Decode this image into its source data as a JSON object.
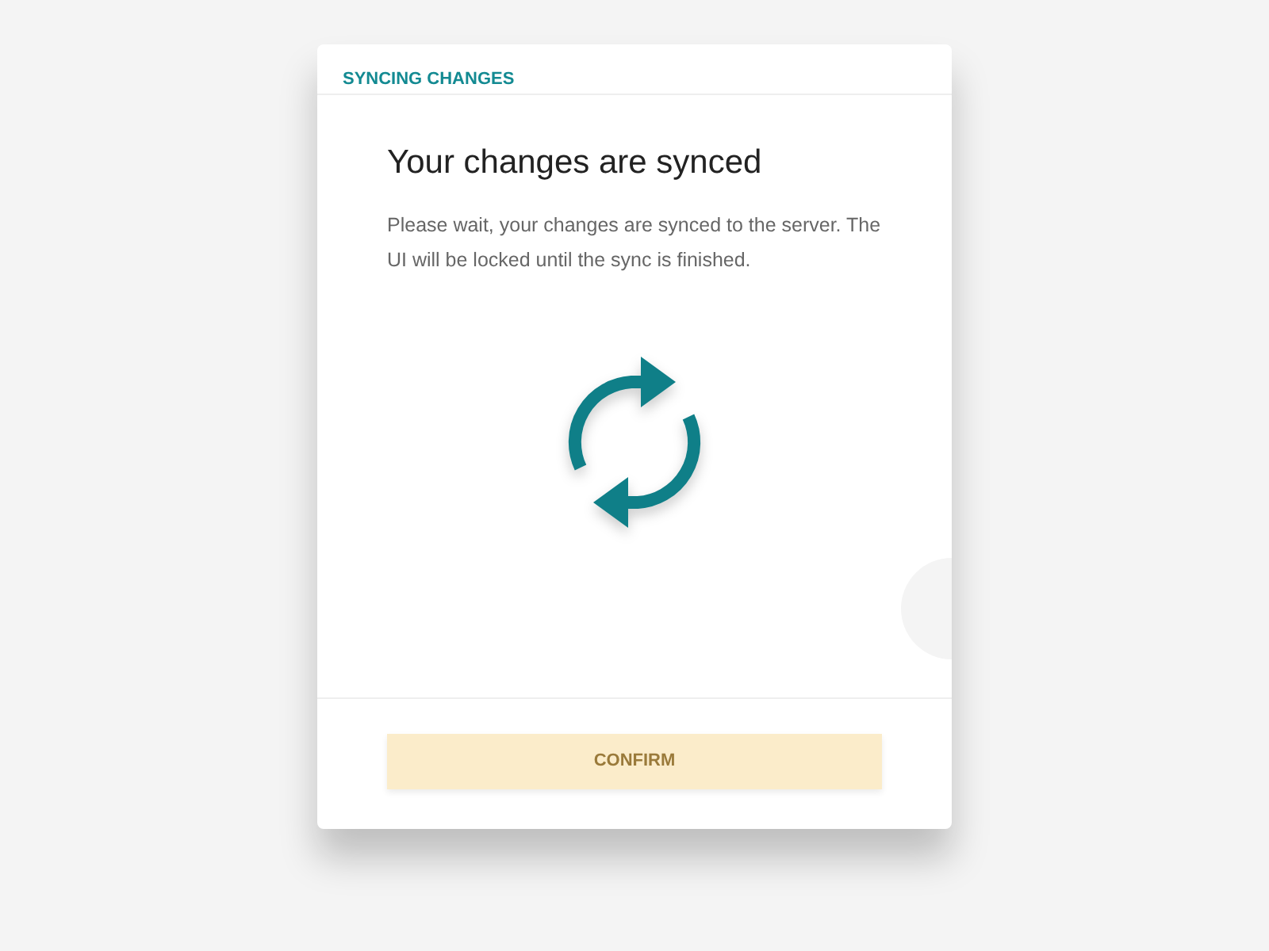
{
  "dialog": {
    "header": "SYNCING CHANGES",
    "title": "Your changes are synced",
    "message": "Please wait, your changes are synced to the server. The UI will be locked until the sync is finished.",
    "button": {
      "label": "CONFIRM",
      "disabled": true
    }
  }
}
